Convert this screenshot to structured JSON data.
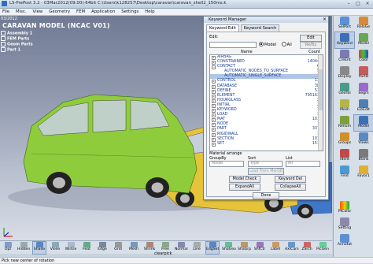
{
  "window": {
    "title": "LS-PrePost 3.2 - 03Mar2012(09:00)-64bit C:\\Users\\k128257\\Desktop\\caravan\\caravan_shell2_150ms.k"
  },
  "menu": [
    "File",
    "Misc.",
    "View",
    "Geometry",
    "FEM",
    "Application",
    "Settings",
    "Help"
  ],
  "viewport": {
    "date": "03/2012",
    "title": "CARAVAN MODEL (NCAC V01)",
    "tree": [
      "Assembly 1",
      "FEM Parts",
      "Geom Parts",
      "Part 1"
    ],
    "colors": {
      "green_van": "#8fcc3b",
      "yellow_car": "#e5c43a",
      "blue_car": "#3f78c8"
    }
  },
  "keyword_manager": {
    "title": "Keyword Manager",
    "tabs": [
      "Keyword Edit",
      "Keyword Search"
    ],
    "edit_label": "Edit:",
    "edit_button": "Edit",
    "reply_button": "Re/By",
    "radio_model": "Model",
    "radio_all": "All",
    "col_name": "Name",
    "col_count": "Count",
    "rows": [
      {
        "name": "AIRBAG",
        "count": "1"
      },
      {
        "name": "CONSTRAINED",
        "count": "14044"
      },
      {
        "name": "CONTACT",
        "count": "6"
      },
      {
        "name": "AUTOMATIC_NODES_TO_SURFACE",
        "count": "5"
      },
      {
        "name": "AUTOMATIC_SINGLE_SURFACE",
        "count": "1"
      },
      {
        "name": "CONTROL",
        "count": "13"
      },
      {
        "name": "DATABASE",
        "count": "38"
      },
      {
        "name": "DEFINE",
        "count": "53"
      },
      {
        "name": "ELEMENT",
        "count": "795163"
      },
      {
        "name": "HOURGLASS",
        "count": "2"
      },
      {
        "name": "INITIAL",
        "count": "2"
      },
      {
        "name": "KEYWORD",
        "count": "1"
      },
      {
        "name": "LOAD",
        "count": "3"
      },
      {
        "name": "MAT",
        "count": "101"
      },
      {
        "name": "NODE",
        "count": "1"
      },
      {
        "name": "PART",
        "count": "337"
      },
      {
        "name": "RIGIDWALL",
        "count": "1"
      },
      {
        "name": "SECTION",
        "count": "103"
      },
      {
        "name": "SET",
        "count": "151"
      }
    ],
    "material_arrange": "Material arrange",
    "group_by": "GroupBy",
    "sort": "Sort",
    "list": "List",
    "group_value": "Model",
    "sort_value": "Type",
    "list_value": "All",
    "load_from_merdb": "Load From MerDB",
    "model_check": "Model Check",
    "keyword_del": "Keyword Del",
    "expand_all": "ExpandAll",
    "collapse_all": "CollapseAll",
    "done": "Done"
  },
  "right_toolbar": [
    "SelPart",
    "ReloGe",
    "Keyword",
    "Model",
    "CreEnt",
    "Color",
    "Display",
    "PartD",
    "GeoTol",
    "Segm",
    "Mesh",
    "EleEdit",
    "Renum",
    "Model",
    "Groups",
    "Views",
    "Ident",
    "Blank",
    "Find",
    "Favor1",
    "PtColor",
    "Setting",
    "Annotat"
  ],
  "bottom_toolbar": [
    "Opt",
    "Hidden",
    "Shade",
    "Vieile",
    "WirEle",
    "Feat",
    "Edge",
    "Grid",
    "Mesh",
    "Shrink",
    "Free",
    "Normal",
    "Line",
    "EdgSet",
    "ShaGeo",
    "ShaGrp",
    "ShfCtr",
    "Label",
    "AxiCam",
    "ZSrch",
    "PicGen"
  ],
  "bottom_hint": "clearpick",
  "status": "Pick new center of rotation"
}
